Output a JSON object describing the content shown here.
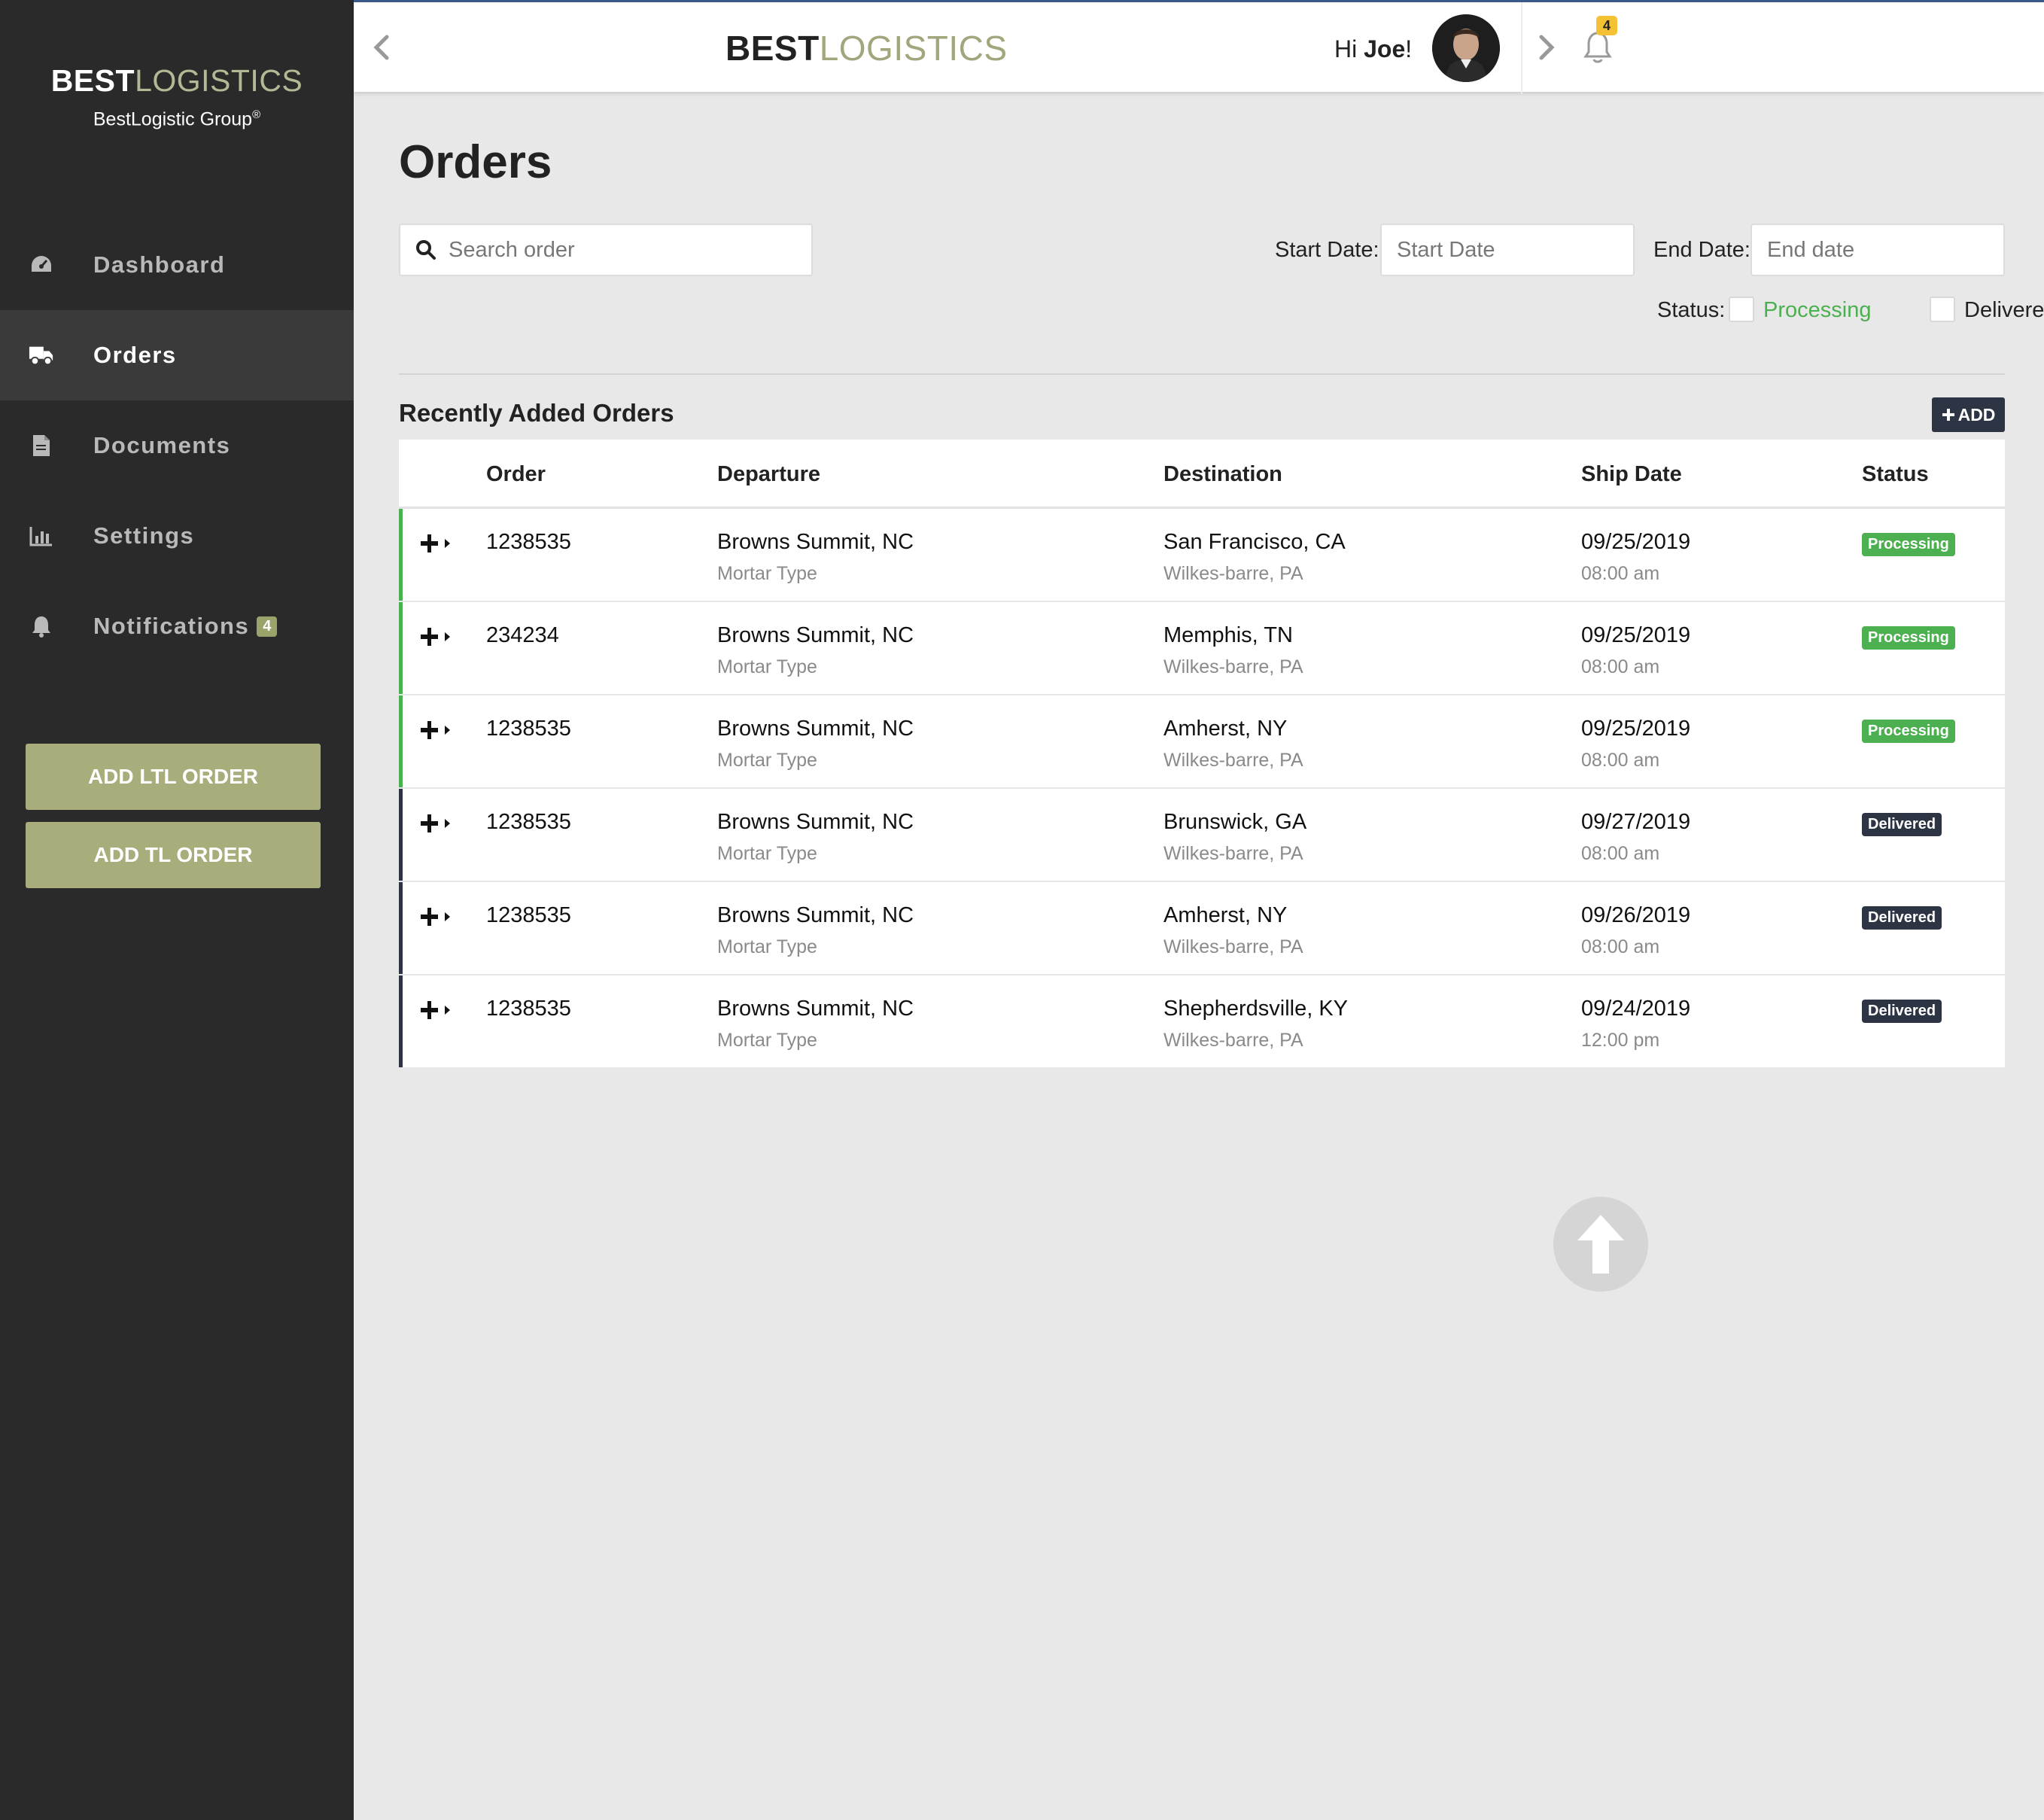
{
  "sidebar": {
    "brand_bold": "BEST",
    "brand_light": "LOGISTICS",
    "group": "BestLogistic Group",
    "group_mark": "®",
    "items": [
      {
        "label": "Dashboard",
        "icon": "dashboard-gauge-icon"
      },
      {
        "label": "Orders",
        "icon": "truck-icon",
        "active": true
      },
      {
        "label": "Documents",
        "icon": "document-icon"
      },
      {
        "label": "Settings",
        "icon": "bar-chart-icon"
      },
      {
        "label": "Notifications",
        "icon": "bell-icon",
        "badge": "4"
      }
    ],
    "add_ltl": "ADD LTL ORDER",
    "add_tl": "ADD TL ORDER"
  },
  "topbar": {
    "brand_bold": "BEST",
    "brand_light": "LOGISTICS",
    "greeting_prefix": "Hi ",
    "user_name": "Joe",
    "greeting_suffix": "!",
    "notification_count": "4"
  },
  "main": {
    "title": "Orders",
    "search_placeholder": "Search order",
    "start_date_label": "Start Date:",
    "start_date_placeholder": "Start Date",
    "end_date_label": "End Date:",
    "end_date_placeholder": "End date",
    "status_label": "Status:",
    "status_processing": "Processing",
    "status_delivered": "Delivered",
    "section_title": "Recently Added Orders",
    "add_label": "ADD"
  },
  "table": {
    "columns": [
      "Order",
      "Departure",
      "Destination",
      "Ship Date",
      "Status"
    ],
    "rows": [
      {
        "order": "1238535",
        "departure": "Browns Summit, NC",
        "departure_sub": "Mortar Type",
        "destination": "San Francisco, CA",
        "destination_sub": "Wilkes-barre, PA",
        "date": "09/25/2019",
        "time": "08:00 am",
        "status": "Processing"
      },
      {
        "order": "234234",
        "departure": "Browns Summit, NC",
        "departure_sub": "Mortar Type",
        "destination": "Memphis, TN",
        "destination_sub": "Wilkes-barre, PA",
        "date": "09/25/2019",
        "time": "08:00 am",
        "status": "Processing"
      },
      {
        "order": "1238535",
        "departure": "Browns Summit, NC",
        "departure_sub": "Mortar Type",
        "destination": "Amherst, NY",
        "destination_sub": "Wilkes-barre, PA",
        "date": "09/25/2019",
        "time": "08:00 am",
        "status": "Processing"
      },
      {
        "order": "1238535",
        "departure": "Browns Summit, NC",
        "departure_sub": "Mortar Type",
        "destination": "Brunswick, GA",
        "destination_sub": "Wilkes-barre, PA",
        "date": "09/27/2019",
        "time": "08:00 am",
        "status": "Delivered"
      },
      {
        "order": "1238535",
        "departure": "Browns Summit, NC",
        "departure_sub": "Mortar Type",
        "destination": "Amherst, NY",
        "destination_sub": "Wilkes-barre, PA",
        "date": "09/26/2019",
        "time": "08:00 am",
        "status": "Delivered"
      },
      {
        "order": "1238535",
        "departure": "Browns Summit, NC",
        "departure_sub": "Mortar Type",
        "destination": "Shepherdsville, KY",
        "destination_sub": "Wilkes-barre, PA",
        "date": "09/24/2019",
        "time": "12:00 pm",
        "status": "Delivered"
      }
    ]
  },
  "colors": {
    "processing": "#4caf50",
    "delivered": "#2d3444",
    "accent_olive": "#a8ad7b",
    "sidebar_bg": "#2a2a2a"
  }
}
